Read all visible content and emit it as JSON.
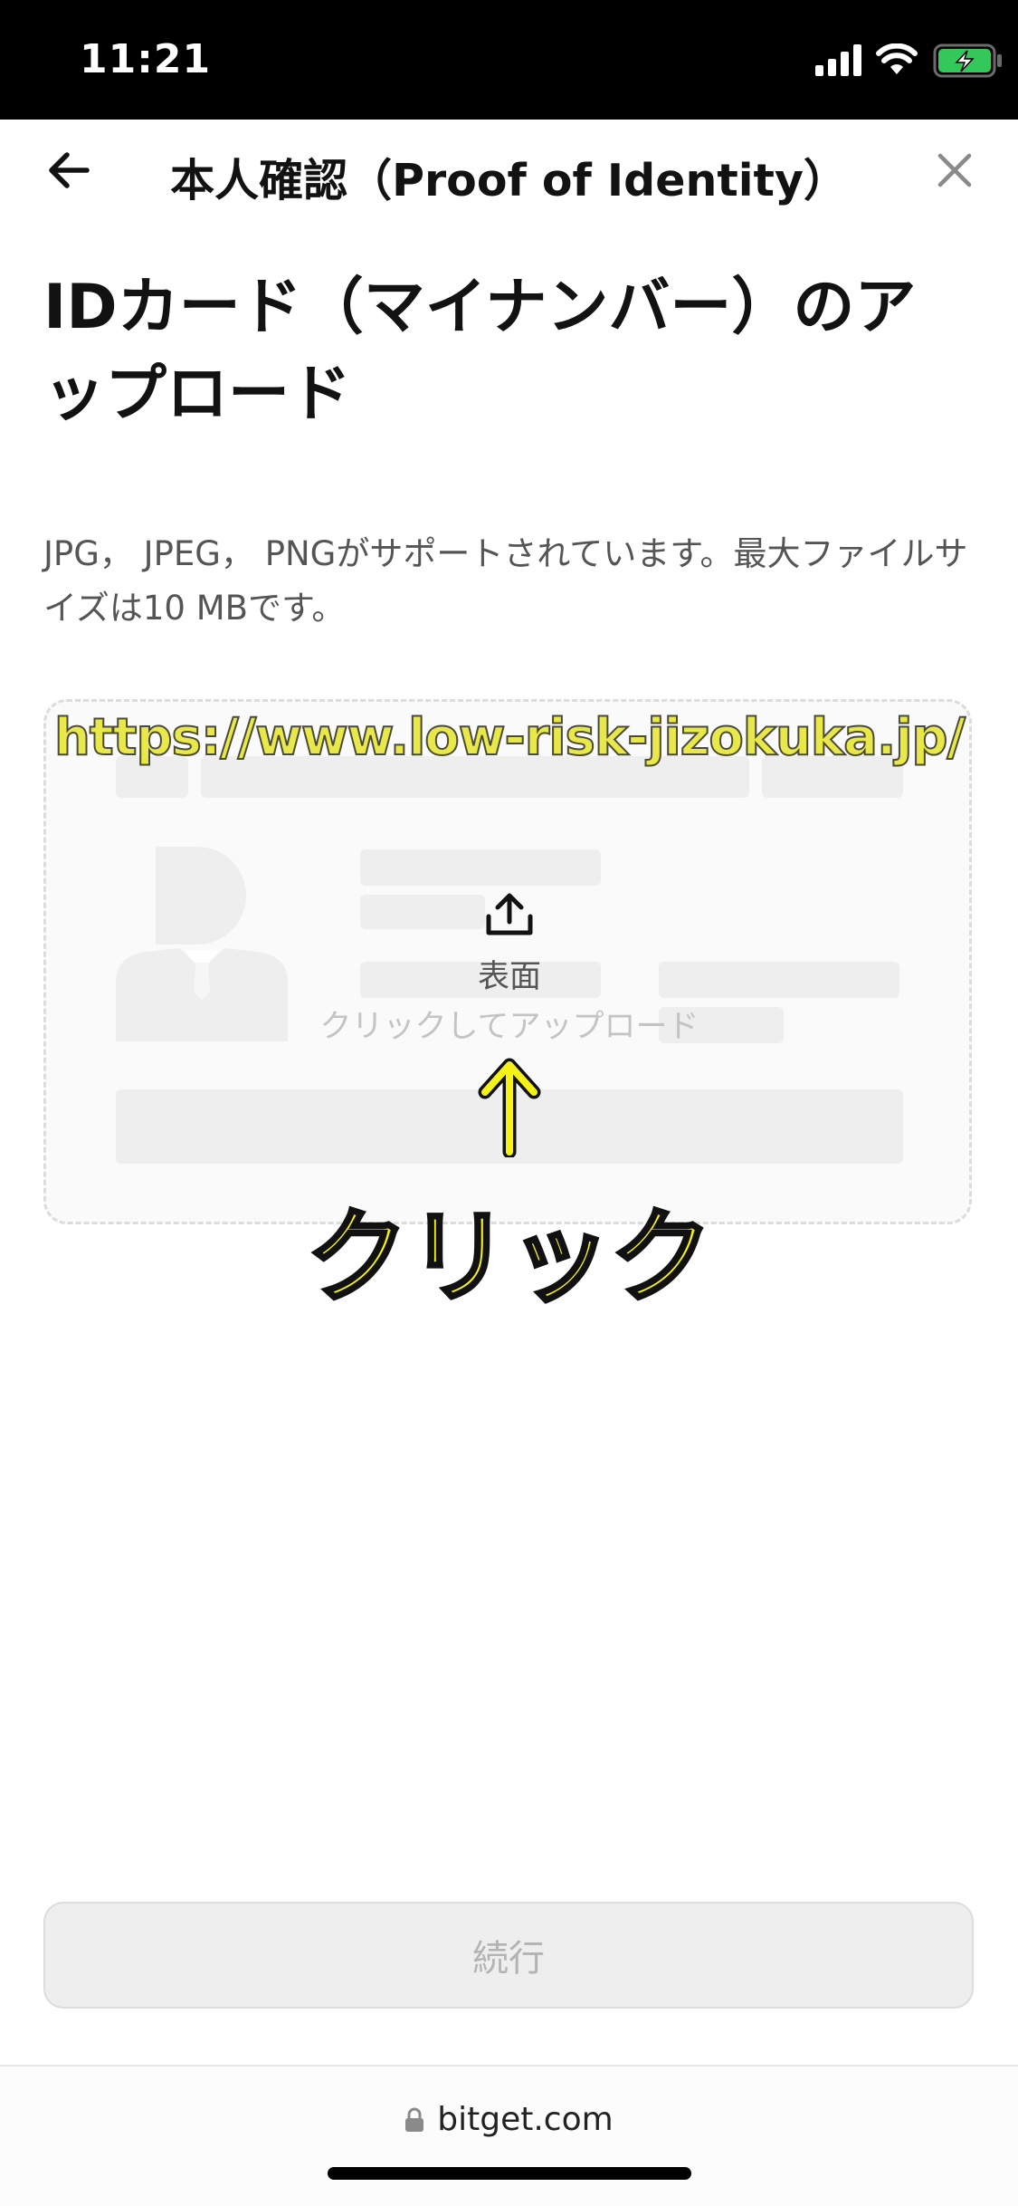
{
  "status_bar": {
    "time": "11:21"
  },
  "icons": {
    "signal": "cellular-signal-icon",
    "wifi": "wifi-icon",
    "battery": "battery-charging-icon",
    "back": "arrow-left-icon",
    "close": "close-icon",
    "upload": "upload-icon",
    "lock": "lock-icon"
  },
  "colors": {
    "accent_annotation": "#f5f21a",
    "battery_green": "#34c759"
  },
  "nav": {
    "title": "本人確認（Proof of Identity）"
  },
  "page": {
    "title": "IDカード（マイナンバー）のアップロード",
    "description": "JPG， JPEG， PNGがサポートされています。最大ファイルサイズは10 MBです。"
  },
  "upload": {
    "side_label": "表面",
    "hint": "クリックしてアップロード"
  },
  "annotations": {
    "watermark": "https://www.low-risk-jizokuka.jp/",
    "click_label": "クリック"
  },
  "footer": {
    "continue_label": "続行"
  },
  "browser": {
    "url": "bitget.com"
  }
}
